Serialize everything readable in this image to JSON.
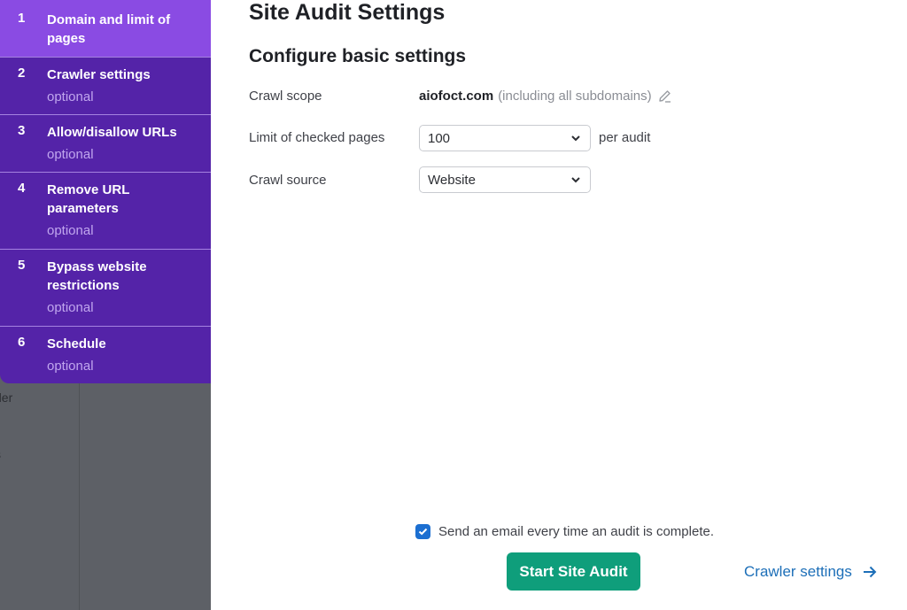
{
  "background": {
    "fragments": [
      "der",
      "s"
    ]
  },
  "steps": [
    {
      "number": "1",
      "title": "Domain and limit of pages",
      "optional": null,
      "active": true
    },
    {
      "number": "2",
      "title": "Crawler settings",
      "optional": "optional",
      "active": false
    },
    {
      "number": "3",
      "title": "Allow/disallow URLs",
      "optional": "optional",
      "active": false
    },
    {
      "number": "4",
      "title": "Remove URL parameters",
      "optional": "optional",
      "active": false
    },
    {
      "number": "5",
      "title": "Bypass website restrictions",
      "optional": "optional",
      "active": false
    },
    {
      "number": "6",
      "title": "Schedule",
      "optional": "optional",
      "active": false
    }
  ],
  "main": {
    "title": "Site Audit Settings",
    "section_title": "Configure basic settings",
    "crawl_scope": {
      "label": "Crawl scope",
      "domain": "aiofoct.com",
      "note": "(including all subdomains)",
      "icon": "pencil-icon"
    },
    "limit": {
      "label": "Limit of checked pages",
      "value": "100",
      "suffix": "per audit"
    },
    "source": {
      "label": "Crawl source",
      "value": "Website"
    },
    "email": {
      "checked": true,
      "label": "Send an email every time an audit is complete."
    },
    "start_button": "Start Site Audit",
    "next_link": "Crawler settings"
  },
  "colors": {
    "sidebar": "#5423a8",
    "sidebar_active": "#8a4be3",
    "primary_button": "#0f9e7b",
    "link": "#1d6fb8",
    "checkbox": "#1c6fd1"
  }
}
